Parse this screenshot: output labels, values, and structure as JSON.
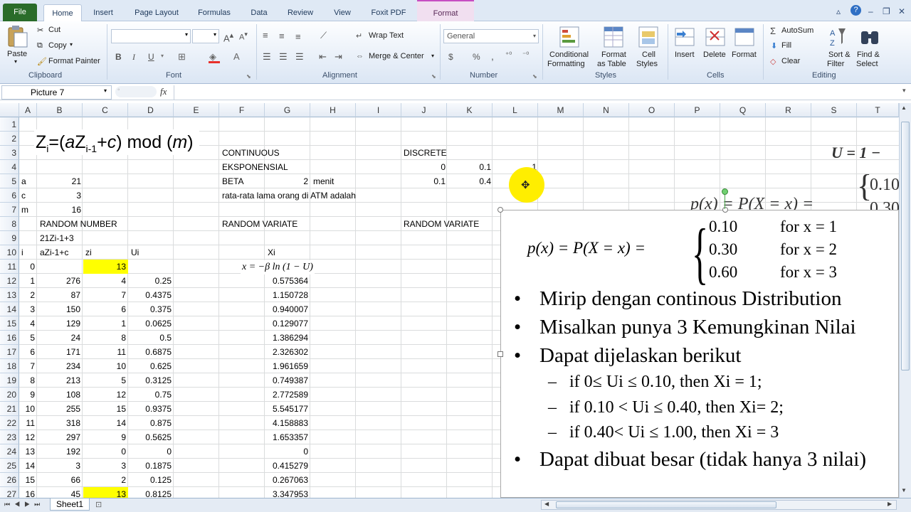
{
  "tabs": [
    {
      "label": "File",
      "kind": "file"
    },
    {
      "label": "Home",
      "kind": "active"
    },
    {
      "label": "Insert",
      "kind": ""
    },
    {
      "label": "Page Layout",
      "kind": ""
    },
    {
      "label": "Formulas",
      "kind": ""
    },
    {
      "label": "Data",
      "kind": ""
    },
    {
      "label": "Review",
      "kind": ""
    },
    {
      "label": "View",
      "kind": ""
    },
    {
      "label": "Foxit PDF",
      "kind": ""
    },
    {
      "label": "Format",
      "kind": "ctx"
    }
  ],
  "ribbon": {
    "clipboard": {
      "paste": "Paste",
      "cut": "Cut",
      "copy": "Copy",
      "format_painter": "Format Painter",
      "group": "Clipboard"
    },
    "font": {
      "group": "Font",
      "bold": "B",
      "italic": "I",
      "underline": "U"
    },
    "alignment": {
      "wrap": "Wrap Text",
      "merge": "Merge & Center",
      "group": "Alignment"
    },
    "number": {
      "format": "General",
      "currency": "$",
      "percent": "%",
      "comma": ",",
      "group": "Number"
    },
    "styles": {
      "conditional": "Conditional",
      "conditional2": "Formatting",
      "format_table": "Format",
      "format_table2": "as Table",
      "cell_styles": "Cell",
      "cell_styles2": "Styles",
      "group": "Styles"
    },
    "cells": {
      "insert": "Insert",
      "delete": "Delete",
      "format": "Format",
      "group": "Cells"
    },
    "editing": {
      "autosum": "AutoSum",
      "fill": "Fill",
      "clear": "Clear",
      "sort": "Sort &",
      "sort2": "Filter",
      "find": "Find &",
      "find2": "Select",
      "group": "Editing"
    }
  },
  "formula_bar": {
    "name_box": "Picture 7",
    "fx": "fx",
    "formula": ""
  },
  "columns": [
    "A",
    "B",
    "C",
    "D",
    "E",
    "F",
    "G",
    "H",
    "I",
    "J",
    "K",
    "L",
    "M",
    "N",
    "O",
    "P",
    "Q",
    "R",
    "S",
    "T"
  ],
  "rows": [
    "1",
    "2",
    "3",
    "4",
    "5",
    "6",
    "7",
    "8",
    "9",
    "10",
    "11",
    "12",
    "13",
    "14",
    "15",
    "16",
    "17",
    "18",
    "19",
    "20",
    "21",
    "22",
    "23",
    "24",
    "25",
    "26",
    "27"
  ],
  "formula_image": {
    "z": "Z",
    "i": "i",
    "eq": "=(",
    "a": "a",
    "zi1": "Z",
    "sub2": "i-1",
    "plus": "+",
    "c": "c",
    "mod": ") mod (",
    "m": "m",
    "close": ")"
  },
  "labels": {
    "continuous": "CONTINUOUS",
    "discrete": "DISCRETE",
    "eksponensial": "EKSPONENSIAL",
    "beta": "BETA",
    "beta_val": "2",
    "menit": "menit",
    "atm": "rata-rata lama orang di ATM adalah",
    "a": "a",
    "a_val": "21",
    "c": "c",
    "c_val": "3",
    "m": "m",
    "m_val": "16",
    "random_number": "RANDOM NUMBER",
    "random_variate_f": "RANDOM VARIATE",
    "random_variate_j": "RANDOM VARIATE",
    "formula_text": "21Zi-1+3",
    "h_i": "i",
    "h_azi": "aZi-1+c",
    "h_zi": "zi",
    "h_ui": "Ui",
    "h_xi": "Xi",
    "expo_formula": "x = −β ln (1 − U)",
    "j4": "0",
    "k4": "0.1",
    "l4": "1",
    "j5": "0.1",
    "k5": "0.4"
  },
  "table": [
    {
      "i": "0",
      "b": "",
      "c": "13",
      "d": "",
      "g": ""
    },
    {
      "i": "1",
      "b": "276",
      "c": "4",
      "d": "0.25",
      "g": "0.575364"
    },
    {
      "i": "2",
      "b": "87",
      "c": "7",
      "d": "0.4375",
      "g": "1.150728"
    },
    {
      "i": "3",
      "b": "150",
      "c": "6",
      "d": "0.375",
      "g": "0.940007"
    },
    {
      "i": "4",
      "b": "129",
      "c": "1",
      "d": "0.0625",
      "g": "0.129077"
    },
    {
      "i": "5",
      "b": "24",
      "c": "8",
      "d": "0.5",
      "g": "1.386294"
    },
    {
      "i": "6",
      "b": "171",
      "c": "11",
      "d": "0.6875",
      "g": "2.326302"
    },
    {
      "i": "7",
      "b": "234",
      "c": "10",
      "d": "0.625",
      "g": "1.961659"
    },
    {
      "i": "8",
      "b": "213",
      "c": "5",
      "d": "0.3125",
      "g": "0.749387"
    },
    {
      "i": "9",
      "b": "108",
      "c": "12",
      "d": "0.75",
      "g": "2.772589"
    },
    {
      "i": "10",
      "b": "255",
      "c": "15",
      "d": "0.9375",
      "g": "5.545177"
    },
    {
      "i": "11",
      "b": "318",
      "c": "14",
      "d": "0.875",
      "g": "4.158883"
    },
    {
      "i": "12",
      "b": "297",
      "c": "9",
      "d": "0.5625",
      "g": "1.653357"
    },
    {
      "i": "13",
      "b": "192",
      "c": "0",
      "d": "0",
      "g": "0"
    },
    {
      "i": "14",
      "b": "3",
      "c": "3",
      "d": "0.1875",
      "g": "0.415279"
    },
    {
      "i": "15",
      "b": "66",
      "c": "2",
      "d": "0.125",
      "g": "0.267063"
    },
    {
      "i": "16",
      "b": "45",
      "c": "13",
      "d": "0.8125",
      "g": "3.347953"
    }
  ],
  "slide": {
    "pmf_lhs": "p(x) = P(X = x) =",
    "cases": [
      {
        "val": "0.10",
        "cond": "for x = 1"
      },
      {
        "val": "0.30",
        "cond": "for x = 2"
      },
      {
        "val": "0.60",
        "cond": "for x = 3"
      }
    ],
    "bullets": [
      "Mirip dengan continous Distribution",
      "Misalkan punya 3 Kemungkinan Nilai",
      "Dapat dijelaskan berikut"
    ],
    "subs": [
      "if 0≤ Ui ≤ 0.10, then Xi = 1;",
      "if 0.10 < Ui ≤ 0.40, then  Xi= 2;",
      "if 0.40< Ui ≤ 1.00, then  Xi = 3"
    ],
    "last_bullet": "Dapat dibuat besar (tidak hanya 3 nilai)",
    "bullet_char": "•",
    "dash_char": "–"
  },
  "bg_image": {
    "u_eq": "U = 1 −",
    "pmf": "p(x) = P(X = x) =",
    "v1": "0.10",
    "v2": "0.30"
  },
  "sheet": {
    "name": "Sheet1"
  },
  "colors": {
    "highlight": "#ffff00",
    "file_tab": "#2a6c2a",
    "cursor": "#ffee00"
  }
}
